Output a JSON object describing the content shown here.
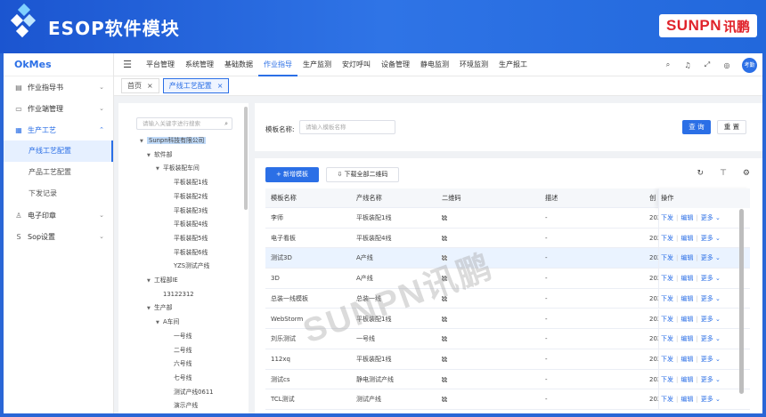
{
  "banner": {
    "title": "ESOP软件模块",
    "brand_text": "SUNPN",
    "brand_cn": "讯鹏"
  },
  "app_name": "OkMes",
  "sidebar": {
    "items": [
      {
        "label": "作业指导书",
        "icon": "document-icon",
        "chevron": "⌄"
      },
      {
        "label": "作业端管理",
        "icon": "monitor-icon",
        "chevron": "⌄"
      },
      {
        "label": "生产工艺",
        "icon": "craft-icon",
        "chevron": "⌃",
        "children": [
          "产线工艺配置",
          "产品工艺配置",
          "下发记录"
        ]
      },
      {
        "label": "电子印章",
        "icon": "stamp-icon",
        "chevron": "⌄"
      },
      {
        "label": "Sop设置",
        "icon": "sop-icon",
        "chevron": "⌄"
      }
    ]
  },
  "topnav": {
    "tabs": [
      "平台管理",
      "系统管理",
      "基础数据",
      "作业指导",
      "生产监测",
      "安灯呼叫",
      "设备管理",
      "静电监测",
      "环境监测",
      "生产报工"
    ],
    "active_index": 3,
    "avatar": "考勤"
  },
  "tags": [
    {
      "label": "首页",
      "close": "×"
    },
    {
      "label": "产线工艺配置",
      "close": "×"
    }
  ],
  "tree": {
    "search_placeholder": "请输入关键字进行搜索",
    "nodes": [
      {
        "label": "Sunpn科技有限公司",
        "arrow": "▼"
      },
      {
        "label": "软件部",
        "arrow": "▼"
      },
      {
        "label": "平板装配车间",
        "arrow": "▼"
      },
      {
        "label": "平板装配1线",
        "arrow": ""
      },
      {
        "label": "平板装配2线",
        "arrow": ""
      },
      {
        "label": "平板装配3线",
        "arrow": ""
      },
      {
        "label": "平板装配4线",
        "arrow": ""
      },
      {
        "label": "平板装配5线",
        "arrow": ""
      },
      {
        "label": "平板装配6线",
        "arrow": ""
      },
      {
        "label": "YZS测试产线",
        "arrow": ""
      },
      {
        "label": "工程部IE",
        "arrow": "▼"
      },
      {
        "label": "13122312",
        "arrow": ""
      },
      {
        "label": "生产部",
        "arrow": "▼"
      },
      {
        "label": "A车间",
        "arrow": "▼"
      },
      {
        "label": "一号线",
        "arrow": ""
      },
      {
        "label": "二号线",
        "arrow": ""
      },
      {
        "label": "六号线",
        "arrow": ""
      },
      {
        "label": "七号线",
        "arrow": ""
      },
      {
        "label": "测试产线0611",
        "arrow": ""
      },
      {
        "label": "演示产线",
        "arrow": ""
      }
    ]
  },
  "search_form": {
    "label": "模板名称:",
    "placeholder": "请输入模板名称",
    "query_btn": "查 询",
    "reset_btn": "重 置"
  },
  "toolbar": {
    "add_btn": "+ 新增模板",
    "download_btn": "下载全部二维码"
  },
  "table": {
    "headers": [
      "模板名称",
      "产线名称",
      "二维码",
      "描述",
      "创",
      "操作"
    ],
    "rows": [
      {
        "name": "李师",
        "line": "平板装配1线",
        "desc": "-",
        "created": "202"
      },
      {
        "name": "电子看板",
        "line": "平板装配4线",
        "desc": "-",
        "created": "202"
      },
      {
        "name": "测试3D",
        "line": "A产线",
        "desc": "-",
        "created": "202"
      },
      {
        "name": "3D",
        "line": "A产线",
        "desc": "-",
        "created": "202"
      },
      {
        "name": "总装一线模板",
        "line": "总装一线",
        "desc": "-",
        "created": "202"
      },
      {
        "name": "WebStorm",
        "line": "平板装配1线",
        "desc": "-",
        "created": "202"
      },
      {
        "name": "刘乐测试",
        "line": "一号线",
        "desc": "-",
        "created": "202"
      },
      {
        "name": "112xq",
        "line": "平板装配1线",
        "desc": "-",
        "created": "202"
      },
      {
        "name": "测试cs",
        "line": "静电测试产线",
        "desc": "-",
        "created": "202"
      },
      {
        "name": "TCL测试",
        "line": "测试产线",
        "desc": "-",
        "created": "202"
      }
    ],
    "highlight_row": 2,
    "ops": {
      "issue": "下发",
      "edit": "编辑",
      "more": "更多 ⌄"
    }
  },
  "watermark": "SUNPN讯鹏"
}
